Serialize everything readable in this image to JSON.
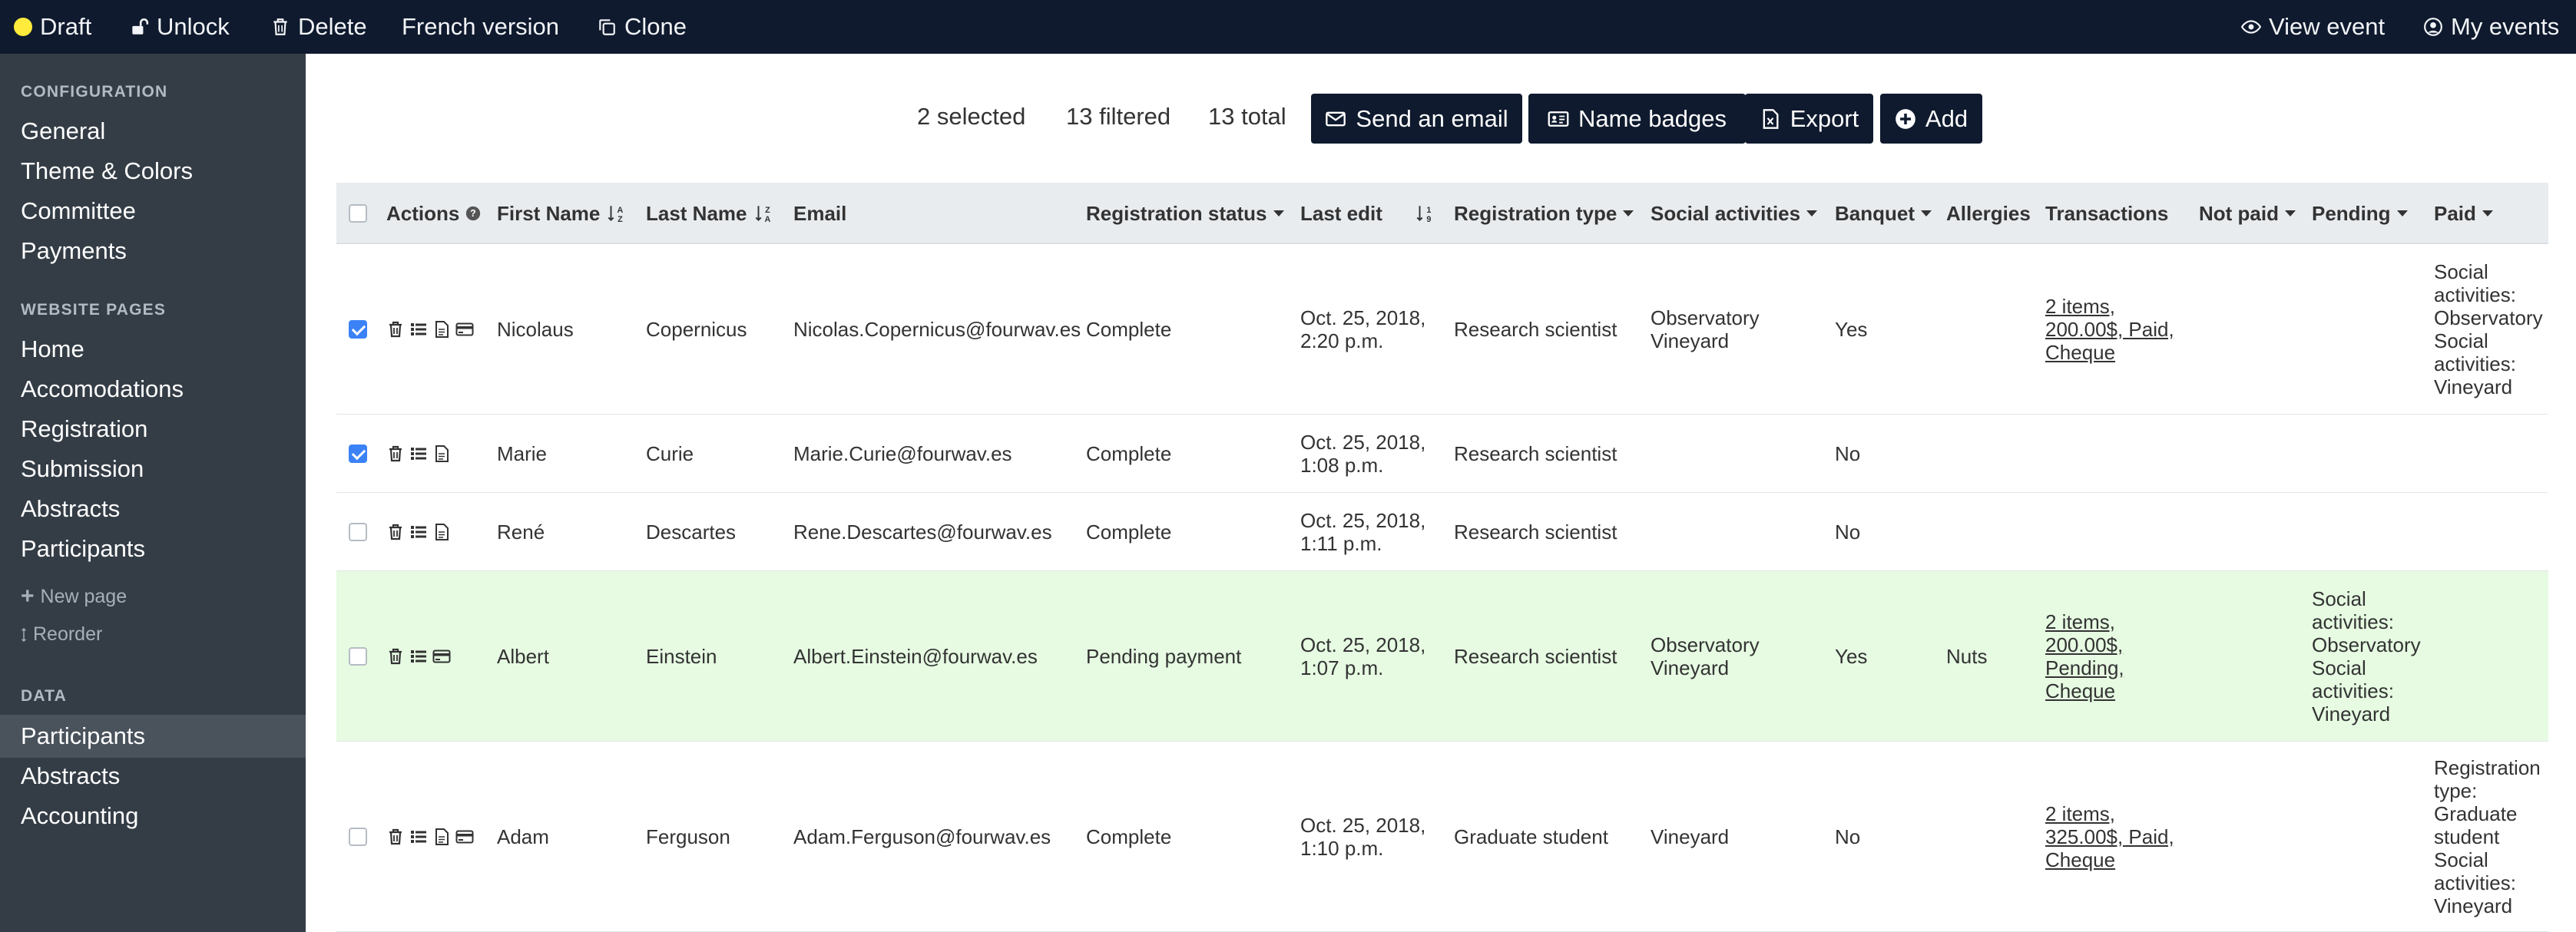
{
  "topbar": {
    "draft": "Draft",
    "unlock": "Unlock",
    "delete": "Delete",
    "french": "French version",
    "clone": "Clone",
    "view_event": "View event",
    "my_events": "My events"
  },
  "sidebar": {
    "config_heading": "CONFIGURATION",
    "config_items": [
      "General",
      "Theme & Colors",
      "Committee",
      "Payments"
    ],
    "website_heading": "WEBSITE PAGES",
    "website_items": [
      "Home",
      "Accomodations",
      "Registration",
      "Submission",
      "Abstracts",
      "Participants"
    ],
    "new_page": "New page",
    "reorder": "Reorder",
    "data_heading": "DATA",
    "data_items": [
      "Participants",
      "Abstracts",
      "Accounting"
    ],
    "active_item": "Participants"
  },
  "toolbar": {
    "selected": "2 selected",
    "filtered": "13 filtered",
    "total": "13 total",
    "send_email": "Send an email",
    "name_badges": "Name badges",
    "export": "Export",
    "add": "Add"
  },
  "table": {
    "headers": {
      "actions": "Actions",
      "first_name": "First Name",
      "last_name": "Last Name",
      "email": "Email",
      "reg_status": "Registration status",
      "last_edit": "Last edit",
      "reg_type": "Registration type",
      "social": "Social activities",
      "banquet": "Banquet",
      "allergies": "Allergies",
      "transactions": "Transactions",
      "not_paid": "Not paid",
      "pending": "Pending",
      "paid": "Paid"
    },
    "rows": [
      {
        "checked": true,
        "first": "Nicolaus",
        "last": "Copernicus",
        "email": "Nicolas.Copernicus@fourwav.es",
        "status": "Complete",
        "edit_1": "Oct. 25, 2018,",
        "edit_2": "2:20 p.m.",
        "type": "Research scientist",
        "social": [
          "Observatory",
          "Vineyard"
        ],
        "banquet": "Yes",
        "allergies": "",
        "transactions": [
          "2 items,",
          "200.00$, Paid,",
          "Cheque"
        ],
        "pending": [],
        "paid": [
          "Social",
          "activities:",
          "Observatory",
          "Social",
          "activities:",
          "Vineyard"
        ]
      },
      {
        "checked": true,
        "first": "Marie",
        "last": "Curie",
        "email": "Marie.Curie@fourwav.es",
        "status": "Complete",
        "edit_1": "Oct. 25, 2018,",
        "edit_2": "1:08 p.m.",
        "type": "Research scientist",
        "social": [],
        "banquet": "No",
        "allergies": "",
        "transactions": [],
        "pending": [],
        "paid": []
      },
      {
        "checked": false,
        "first": "René",
        "last": "Descartes",
        "email": "Rene.Descartes@fourwav.es",
        "status": "Complete",
        "edit_1": "Oct. 25, 2018,",
        "edit_2": "1:11 p.m.",
        "type": "Research scientist",
        "social": [],
        "banquet": "No",
        "allergies": "",
        "transactions": [],
        "pending": [],
        "paid": []
      },
      {
        "checked": false,
        "first": "Albert",
        "last": "Einstein",
        "email": "Albert.Einstein@fourwav.es",
        "status": "Pending payment",
        "edit_1": "Oct. 25, 2018,",
        "edit_2": "1:07 p.m.",
        "type": "Research scientist",
        "social": [
          "Observatory",
          "Vineyard"
        ],
        "banquet": "Yes",
        "allergies": "Nuts",
        "transactions": [
          "2 items,",
          "200.00$,",
          "Pending,",
          "Cheque"
        ],
        "pending": [
          "Social",
          "activities:",
          "Observatory",
          "Social",
          "activities:",
          "Vineyard"
        ],
        "paid": []
      },
      {
        "checked": false,
        "first": "Adam",
        "last": "Ferguson",
        "email": "Adam.Ferguson@fourwav.es",
        "status": "Complete",
        "edit_1": "Oct. 25, 2018,",
        "edit_2": "1:10 p.m.",
        "type": "Graduate student",
        "social": [
          "Vineyard"
        ],
        "banquet": "No",
        "allergies": "",
        "transactions": [
          "2 items,",
          "325.00$, Paid,",
          "Cheque"
        ],
        "pending": [],
        "paid": [
          "Registration",
          "type:",
          "Graduate",
          "student",
          "Social",
          "activities:",
          "Vineyard"
        ]
      }
    ]
  },
  "colors": {
    "topbar_bg": "#0f1a2e",
    "sidebar_bg": "#343d46",
    "draft_dot": "#ffeb3b",
    "highlight_row": "#e6fbe2",
    "checkbox_checked": "#3b82f6"
  }
}
